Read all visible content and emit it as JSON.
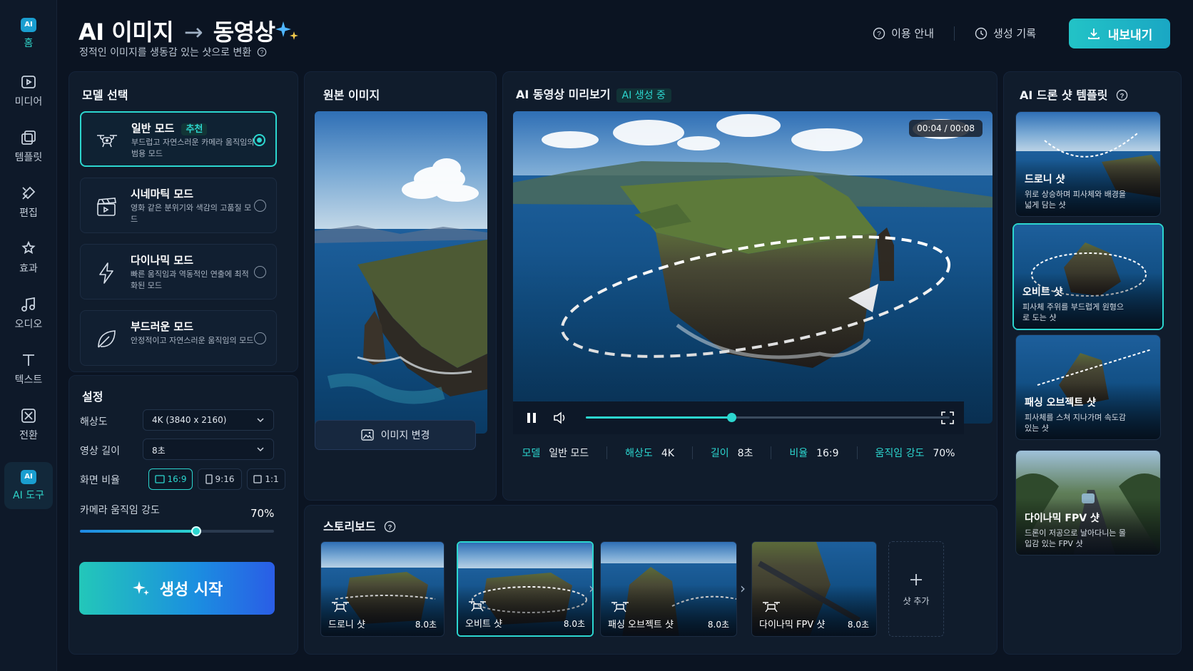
{
  "nav": {
    "items": [
      {
        "label": "홈",
        "icon": "ai-home-icon"
      },
      {
        "label": "미디어",
        "icon": "media-icon"
      },
      {
        "label": "템플릿",
        "icon": "template-icon"
      },
      {
        "label": "편집",
        "icon": "edit-icon"
      },
      {
        "label": "효과",
        "icon": "effects-icon"
      },
      {
        "label": "오디오",
        "icon": "audio-icon"
      },
      {
        "label": "텍스트",
        "icon": "text-icon"
      },
      {
        "label": "전환",
        "icon": "transition-icon"
      },
      {
        "label": "AI 도구",
        "icon": "ai-tool-icon"
      }
    ],
    "badge": "AI"
  },
  "header": {
    "title_left": "AI 이미지",
    "title_arrow": "→",
    "title_right": "동영상",
    "subtitle": "정적인 이미지를 생동감 있는 샷으로 변환",
    "guide": "이용 안내",
    "history": "생성 기록",
    "export": "내보내기"
  },
  "model": {
    "title": "모델 선택",
    "recommended": "추천",
    "modes": [
      {
        "name": "일반 모드",
        "desc": "부드럽고 자연스러운 카메라 움직임의 범용 모드",
        "selected": true
      },
      {
        "name": "시네마틱 모드",
        "desc": "영화 같은 분위기와 색감의 고품질 모드",
        "selected": false
      },
      {
        "name": "다이나믹 모드",
        "desc": "빠른 움직임과 역동적인 연출에 최적화된 모드",
        "selected": false
      },
      {
        "name": "부드러운 모드",
        "desc": "안정적이고 자연스러운 움직임의 모드",
        "selected": false
      }
    ]
  },
  "settings": {
    "title": "설정",
    "resolution_label": "해상도",
    "resolution_value": "4K (3840 x 2160)",
    "length_label": "영상 길이",
    "length_value": "8초",
    "ratio_label": "화면 비율",
    "ratios": [
      "16:9",
      "9:16",
      "1:1"
    ],
    "motion_label": "카메라 움직임 강도",
    "motion_value": "70%",
    "motion_fraction": 0.6,
    "generate": "생성 시작"
  },
  "source": {
    "title": "원본 이미지",
    "change": "이미지 변경"
  },
  "preview": {
    "title": "AI 동영상 미리보기",
    "status": "AI 생성 중",
    "time": "00:04 / 00:08",
    "progress": 0.4,
    "info": [
      {
        "k": "모델",
        "v": "일반 모드"
      },
      {
        "k": "해상도",
        "v": "4K"
      },
      {
        "k": "길이",
        "v": "8초"
      },
      {
        "k": "비율",
        "v": "16:9"
      },
      {
        "k": "움직임 강도",
        "v": "70%"
      }
    ]
  },
  "storyboard": {
    "title": "스토리보드",
    "shots": [
      {
        "name": "드로니 샷",
        "dur": "8.0초"
      },
      {
        "name": "오비트 샷",
        "dur": "8.0초"
      },
      {
        "name": "패싱 오브젝트 샷",
        "dur": "8.0초"
      },
      {
        "name": "다이나믹 FPV 샷",
        "dur": "8.0초"
      }
    ],
    "add": "샷 추가"
  },
  "templates": {
    "title": "AI 드론 샷 템플릿",
    "items": [
      {
        "name": "드로니 샷",
        "desc": "위로 상승하며 피사체와 배경을 넓게 담는 샷"
      },
      {
        "name": "오비트 샷",
        "desc": "피사체 주위를 부드럽게 원형으로 도는 샷"
      },
      {
        "name": "패싱 오브젝트 샷",
        "desc": "피사체를 스쳐 지나가며 속도감 있는 샷"
      },
      {
        "name": "다이나믹 FPV 샷",
        "desc": "드론이 저공으로 날아다니는 몰입감 있는 FPV 샷"
      }
    ]
  },
  "colors": {
    "accent": "#2cd6cf",
    "bg": "#0b1422",
    "panel": "#101c2c"
  }
}
